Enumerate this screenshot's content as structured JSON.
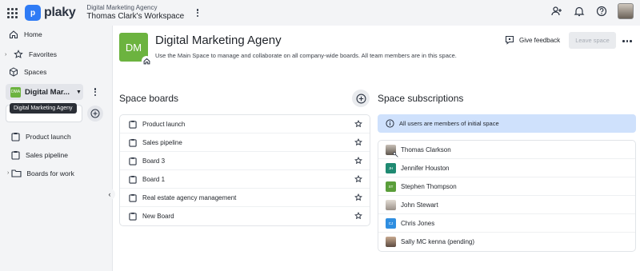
{
  "app": {
    "logo_text": "plaky",
    "logo_mark": "p"
  },
  "workspace": {
    "org": "Digital Marketing Agency",
    "name": "Thomas Clark's Workspace"
  },
  "top_icons": [
    "invite-user-icon",
    "bell-icon",
    "help-icon",
    "avatar"
  ],
  "sidebar": {
    "home": "Home",
    "favorites": "Favorites",
    "spaces": "Spaces",
    "space_select": {
      "badge": "DMA",
      "label": "Digital Mar..."
    },
    "tooltip": "Digital Marketing Ageny",
    "boards": [
      {
        "label": "Product launch",
        "icon": "board-icon"
      },
      {
        "label": "Sales pipeline",
        "icon": "board-icon"
      },
      {
        "label": "Boards for work",
        "icon": "folder-icon"
      }
    ]
  },
  "space": {
    "initials": "DM",
    "title": "Digital Marketing Ageny",
    "description": "Use the Main Space to manage and collaborate on all company-wide boards. All team members are in this space.",
    "feedback_label": "Give feedback",
    "leave_label": "Leave space",
    "accent": "#6cb33f"
  },
  "boards_section": {
    "title": "Space boards",
    "items": [
      "Product launch",
      "Sales pipeline",
      "Board 3",
      "Board 1",
      "Real estate agency management",
      "New Board"
    ]
  },
  "subscriptions": {
    "title": "Space subscriptions",
    "info": "All users are members of initial space",
    "members": [
      {
        "name": "Thomas Clarkson",
        "initials": "",
        "color": "photo",
        "owner": true
      },
      {
        "name": "Jennifer Houston",
        "initials": "JH",
        "color": "#1f8a72",
        "owner": false
      },
      {
        "name": "Stephen Thompson",
        "initials": "ST",
        "color": "#5a9e3a",
        "owner": false
      },
      {
        "name": "John Stewart",
        "initials": "",
        "color": "photo",
        "owner": false
      },
      {
        "name": "Chris Jones",
        "initials": "CJ",
        "color": "#2f8ee0",
        "owner": false
      },
      {
        "name": "Sally MC kenna (pending)",
        "initials": "",
        "color": "photo",
        "owner": false
      }
    ]
  }
}
